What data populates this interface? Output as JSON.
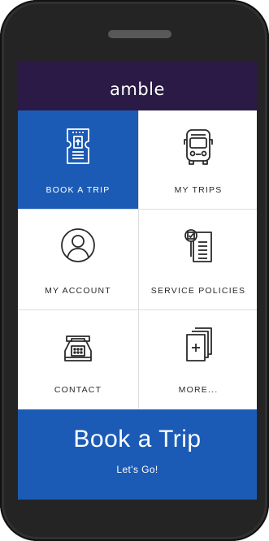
{
  "app": {
    "brand": "amble"
  },
  "menu": {
    "items": [
      {
        "label": "BOOK A TRIP",
        "icon": "ticket-icon",
        "active": true
      },
      {
        "label": "MY TRIPS",
        "icon": "bus-icon",
        "active": false
      },
      {
        "label": "MY ACCOUNT",
        "icon": "user-icon",
        "active": false
      },
      {
        "label": "SERVICE POLICIES",
        "icon": "policy-document-icon",
        "active": false
      },
      {
        "label": "CONTACT",
        "icon": "telephone-icon",
        "active": false
      },
      {
        "label": "MORE...",
        "icon": "add-pages-icon",
        "active": false
      }
    ]
  },
  "cta": {
    "title": "Book a Trip",
    "subtitle": "Let's Go!"
  },
  "colors": {
    "header": "#2a1a45",
    "accent": "#1c5bb5",
    "device": "#242424"
  }
}
